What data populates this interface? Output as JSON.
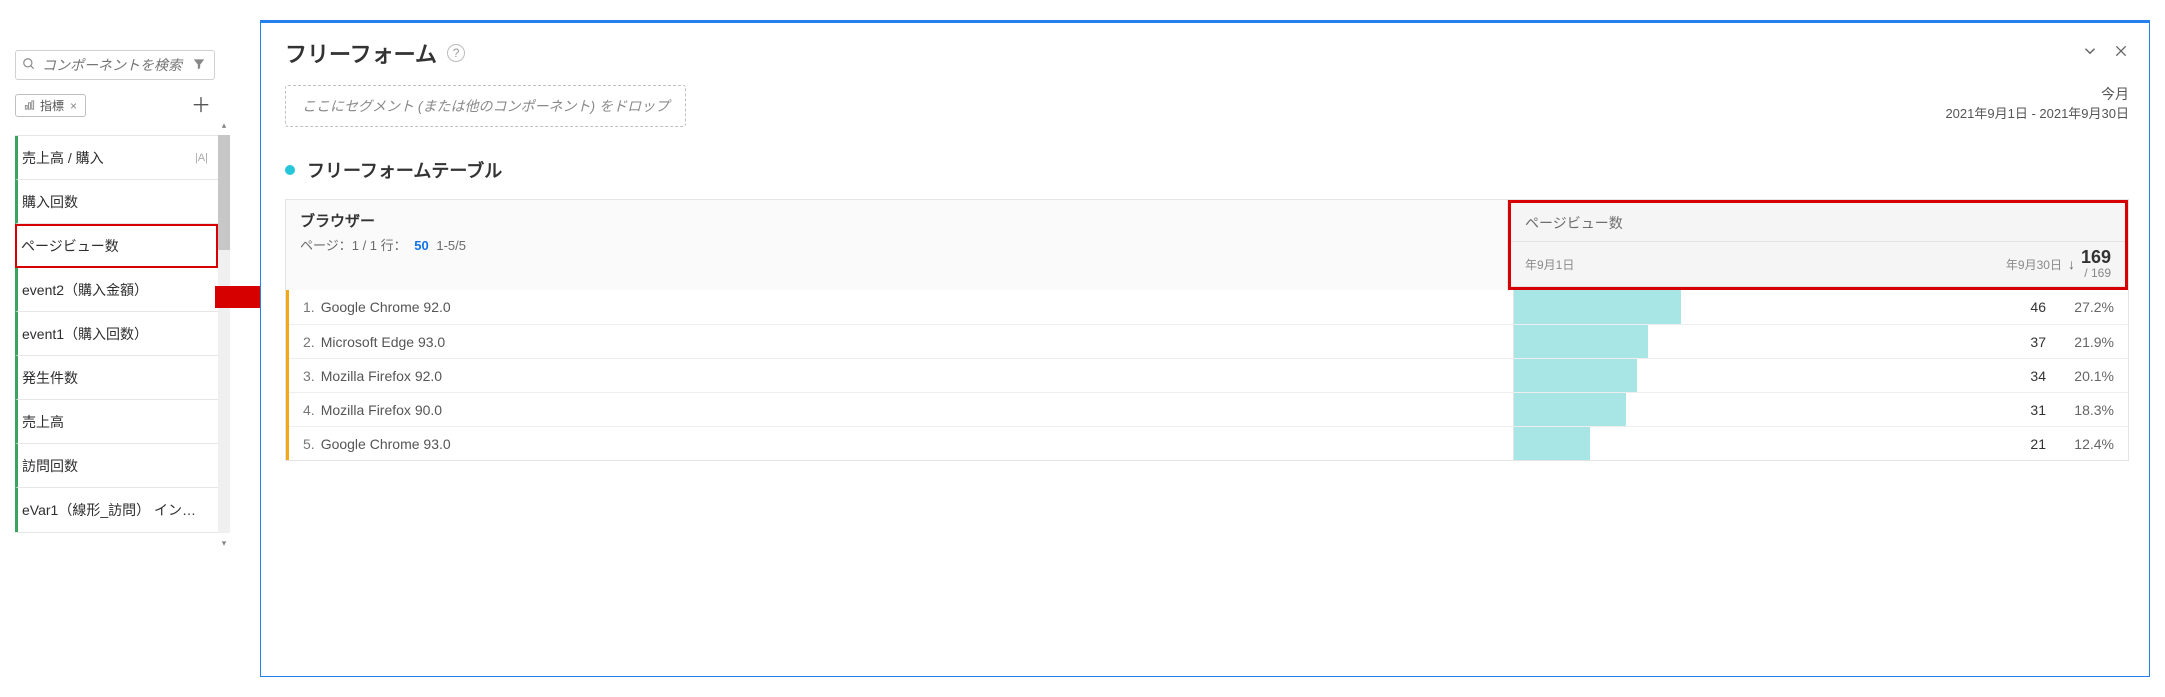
{
  "sidebar": {
    "search_placeholder": "コンポーネントを検索",
    "tag_label": "指標",
    "items": [
      {
        "label": "売上高 / 購入",
        "adobe": true
      },
      {
        "label": "購入回数"
      },
      {
        "label": "ページビュー数",
        "selected": true
      },
      {
        "label": "event2（購入金額）"
      },
      {
        "label": "event1（購入回数）"
      },
      {
        "label": "発生件数"
      },
      {
        "label": "売上高"
      },
      {
        "label": "訪問回数"
      },
      {
        "label": "eVar1（線形_訪問） イン…"
      }
    ]
  },
  "panel": {
    "title": "フリーフォーム",
    "segment_hint": "ここにセグメント (または他のコンポーネント) をドロップ",
    "month_label": "今月",
    "date_text": "2021年9月1日 - 2021年9月30日"
  },
  "table": {
    "title": "フリーフォームテーブル",
    "dimension": "ブラウザー",
    "page_text_a": "ページ：1 / 1 行：",
    "page_rows": "50",
    "page_text_b": "1-5/5",
    "metric": "ページビュー数",
    "total": "169",
    "total_sub": "/ 169",
    "range_start": "年9月1日",
    "range_end": "年9月30日"
  },
  "chart_data": {
    "type": "bar",
    "title": "ページビュー数",
    "categories": [
      "Google Chrome 92.0",
      "Microsoft Edge 93.0",
      "Mozilla Firefox 92.0",
      "Mozilla Firefox 90.0",
      "Google Chrome 93.0"
    ],
    "values": [
      46,
      37,
      34,
      31,
      21
    ],
    "percents": [
      "27.2%",
      "21.9%",
      "20.1%",
      "18.3%",
      "12.4%"
    ],
    "xlabel": "",
    "ylabel": "",
    "ylim": [
      0,
      169
    ]
  }
}
